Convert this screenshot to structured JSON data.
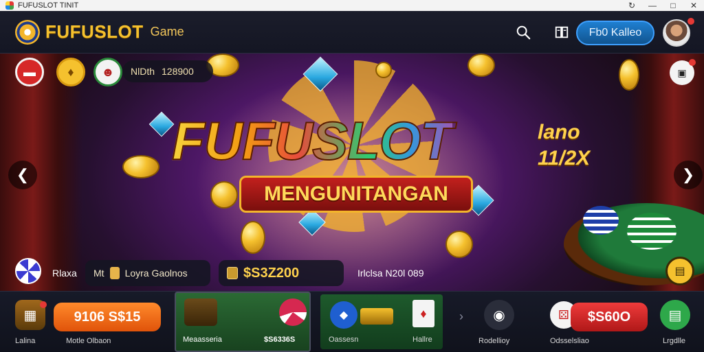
{
  "window": {
    "title": "FUFUSLOT Game",
    "title_bar_text": "FUFUSLOT TINIT",
    "controls": [
      "↻",
      "—",
      "□",
      "✕"
    ]
  },
  "header": {
    "brand": "FUFUSLOT",
    "brand_sub": "Game",
    "login_label": "Fb0 Kalleo",
    "icons": {
      "search": "search-icon",
      "book": "book-icon",
      "avatar": "avatar"
    }
  },
  "banner": {
    "title": "FUFUSLOT",
    "subtitle": "MENGUNITANGAN",
    "side_text_1": "lano",
    "side_text_2": "11/2X",
    "score_label": "NlDth",
    "score_value": "128900",
    "info": {
      "left_label": "Rlaxa",
      "pill1_prefix": "Mt",
      "pill1_text": "Loyra Gaolnos",
      "amount": "$S3Z200",
      "right_text": "Irlclsa N20l 089"
    }
  },
  "bottom": {
    "items": [
      {
        "label": "Lalina",
        "icon": "chest-icon"
      },
      {
        "label": "Motle Olbaon",
        "pill": "9106 S$15"
      },
      {
        "label": "Meaasseria",
        "amount": "$S6336S"
      },
      {
        "label": "Oassesn",
        "icon": "shield-icon"
      },
      {
        "label": "Hallre",
        "icon": "card-icon"
      },
      {
        "label": "Rodellioy",
        "icon": "camera-icon"
      },
      {
        "label": "Odsselsliao",
        "pill": "$S60O"
      },
      {
        "label": "Lrgdlle",
        "icon": "doc-icon"
      }
    ]
  },
  "colors": {
    "accent": "#f5c12e",
    "login": "#1f7fd0",
    "danger": "#e53935"
  }
}
